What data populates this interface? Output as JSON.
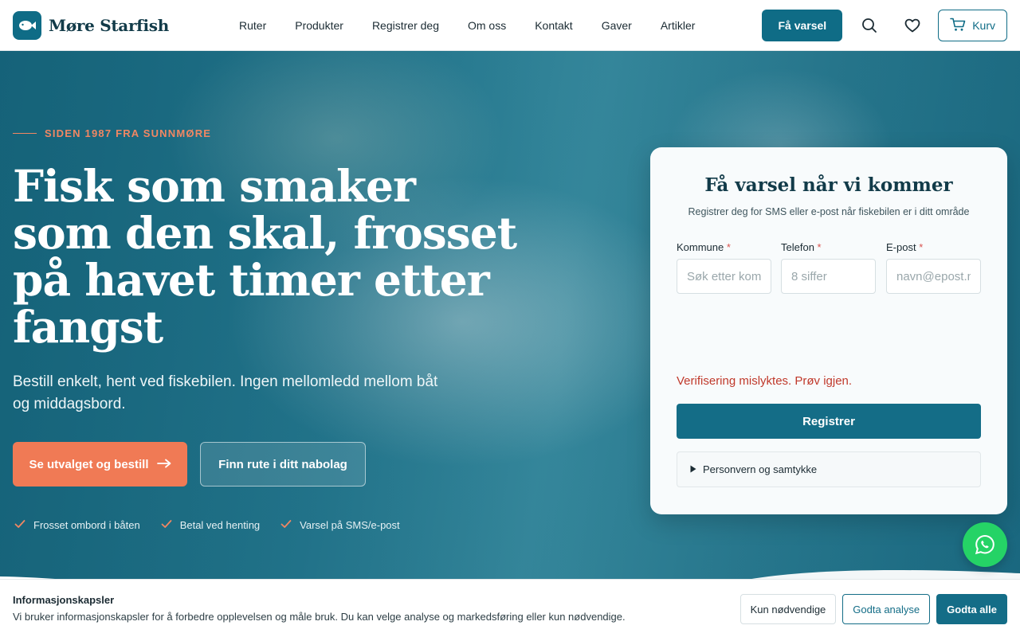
{
  "header": {
    "brand": "Møre Starfish",
    "nav": [
      "Ruter",
      "Produkter",
      "Registrer deg",
      "Om oss",
      "Kontakt",
      "Gaver",
      "Artikler"
    ],
    "notify_label": "Få varsel",
    "cart_label": "Kurv",
    "accent": "#0f6c86"
  },
  "hero": {
    "eyebrow": "SIDEN 1987 FRA SUNNMØRE",
    "title": "Fisk som smaker som den skal, frosset på havet timer etter fangst",
    "subtitle": "Bestill enkelt, hent ved fiskebilen. Ingen mellomledd mellom båt og middagsbord.",
    "cta_primary": "Se utvalget og bestill",
    "cta_secondary": "Finn rute i ditt nabolag",
    "perks": [
      "Frosset ombord i båten",
      "Betal ved henting",
      "Varsel på SMS/e-post"
    ],
    "cta_color": "#f07a55"
  },
  "form": {
    "title": "Få varsel når vi kommer",
    "subtitle": "Registrer deg for SMS eller e-post når fiskebilen er i ditt område",
    "fields": [
      {
        "label": "Kommune",
        "required": "*",
        "placeholder": "Søk etter kommune"
      },
      {
        "label": "Telefon",
        "required": "*",
        "placeholder": "8 siffer"
      },
      {
        "label": "E-post",
        "required": "*",
        "placeholder": "navn@epost.no"
      }
    ],
    "error": "Verifisering mislyktes. Prøv igjen.",
    "submit": "Registrer",
    "privacy": "Personvern og samtykke"
  },
  "cookie": {
    "title": "Informasjonskapsler",
    "text": "Vi bruker informasjonskapsler for å forbedre opplevelsen og måle bruk. Du kan velge analyse og markedsføring eller kun nødvendige.",
    "btn_necessary": "Kun nødvendige",
    "btn_analytics": "Godta analyse",
    "btn_all": "Godta alle"
  },
  "icons": {
    "logo": "fish-icon",
    "search": "search-icon",
    "favorites": "heart-icon",
    "cart": "cart-icon",
    "arrow": "arrow-right-icon",
    "check": "check-icon",
    "whatsapp": "whatsapp-icon"
  }
}
